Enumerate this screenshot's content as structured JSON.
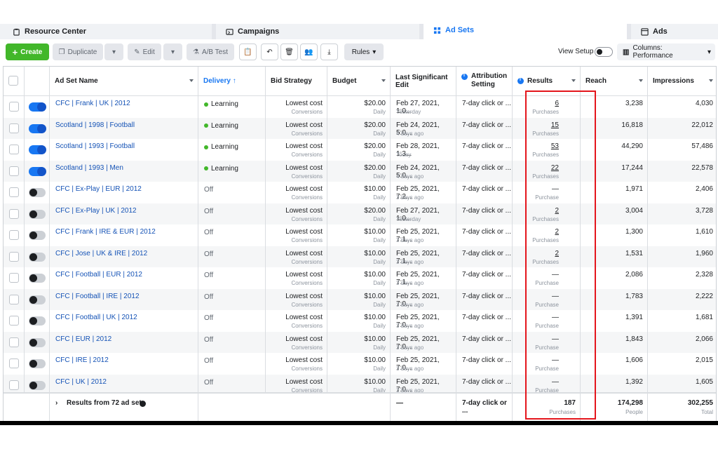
{
  "tabs": [
    {
      "label": "Resource Center",
      "icon": "clipboard-icon"
    },
    {
      "label": "Campaigns",
      "icon": "folder-icon"
    },
    {
      "label": "Ad Sets",
      "icon": "grid-icon"
    },
    {
      "label": "Ads",
      "icon": "window-icon"
    }
  ],
  "toolbar": {
    "create": "Create",
    "duplicate": "Duplicate",
    "edit": "Edit",
    "ab_test": "A/B Test",
    "rules": "Rules",
    "view_setup": "View Setup",
    "columns": "Columns: Performance"
  },
  "headers": {
    "name": "Ad Set Name",
    "delivery": "Delivery ↑",
    "bid": "Bid Strategy",
    "budget": "Budget",
    "last_edit": "Last Significant Edit",
    "attribution": "Attribution Setting",
    "results": "Results",
    "reach": "Reach",
    "impressions": "Impressions"
  },
  "rows": [
    {
      "on": true,
      "name": "CFC | Frank | UK | 2012",
      "delivery": "Learning",
      "bid": "Lowest cost",
      "bid_sub": "Conversions",
      "budget": "$20.00",
      "budget_sub": "Daily",
      "edit": "Feb 27, 2021, 1:0...",
      "edit_sub": "Yesterday",
      "attr": "7-day click or ...",
      "results": "6",
      "results_sub": "Purchases",
      "reach": "3,238",
      "impr": "4,030"
    },
    {
      "on": true,
      "name": "Scotland | 1998 | Football",
      "delivery": "Learning",
      "bid": "Lowest cost",
      "bid_sub": "Conversions",
      "budget": "$20.00",
      "budget_sub": "Daily",
      "edit": "Feb 24, 2021, 5:0...",
      "edit_sub": "4 days ago",
      "attr": "7-day click or ...",
      "results": "15",
      "results_sub": "Purchases",
      "reach": "16,818",
      "impr": "22,012"
    },
    {
      "on": true,
      "name": "Scotland | 1993 | Football",
      "delivery": "Learning",
      "bid": "Lowest cost",
      "bid_sub": "Conversions",
      "budget": "$20.00",
      "budget_sub": "Daily",
      "edit": "Feb 28, 2021, 1:3...",
      "edit_sub": "Today",
      "attr": "7-day click or ...",
      "results": "53",
      "results_sub": "Purchases",
      "reach": "44,290",
      "impr": "57,486"
    },
    {
      "on": true,
      "name": "Scotland | 1993 | Men",
      "delivery": "Learning",
      "bid": "Lowest cost",
      "bid_sub": "Conversions",
      "budget": "$20.00",
      "budget_sub": "Daily",
      "edit": "Feb 24, 2021, 5:0...",
      "edit_sub": "4 days ago",
      "attr": "7-day click or ...",
      "results": "22",
      "results_sub": "Purchases",
      "reach": "17,244",
      "impr": "22,578"
    },
    {
      "on": false,
      "name": "CFC | Ex-Play | EUR | 2012",
      "delivery": "Off",
      "bid": "Lowest cost",
      "bid_sub": "Conversions",
      "budget": "$10.00",
      "budget_sub": "Daily",
      "edit": "Feb 25, 2021, 7:2...",
      "edit_sub": "3 days ago",
      "attr": "7-day click or ...",
      "results": "—",
      "results_sub": "Purchase",
      "reach": "1,971",
      "impr": "2,406"
    },
    {
      "on": false,
      "name": "CFC | Ex-Play | UK | 2012",
      "delivery": "Off",
      "bid": "Lowest cost",
      "bid_sub": "Conversions",
      "budget": "$20.00",
      "budget_sub": "Daily",
      "edit": "Feb 27, 2021, 1:0...",
      "edit_sub": "Yesterday",
      "attr": "7-day click or ...",
      "results": "2",
      "results_sub": "Purchases",
      "reach": "3,004",
      "impr": "3,728"
    },
    {
      "on": false,
      "name": "CFC | Frank | IRE & EUR | 2012",
      "delivery": "Off",
      "bid": "Lowest cost",
      "bid_sub": "Conversions",
      "budget": "$10.00",
      "budget_sub": "Daily",
      "edit": "Feb 25, 2021, 7:1...",
      "edit_sub": "3 days ago",
      "attr": "7-day click or ...",
      "results": "2",
      "results_sub": "Purchases",
      "reach": "1,300",
      "impr": "1,610"
    },
    {
      "on": false,
      "name": "CFC | Jose | UK & IRE | 2012",
      "delivery": "Off",
      "bid": "Lowest cost",
      "bid_sub": "Conversions",
      "budget": "$10.00",
      "budget_sub": "Daily",
      "edit": "Feb 25, 2021, 7:1...",
      "edit_sub": "3 days ago",
      "attr": "7-day click or ...",
      "results": "2",
      "results_sub": "Purchases",
      "reach": "1,531",
      "impr": "1,960"
    },
    {
      "on": false,
      "name": "CFC | Football | EUR | 2012",
      "delivery": "Off",
      "bid": "Lowest cost",
      "bid_sub": "Conversions",
      "budget": "$10.00",
      "budget_sub": "Daily",
      "edit": "Feb 25, 2021, 7:1...",
      "edit_sub": "3 days ago",
      "attr": "7-day click or ...",
      "results": "—",
      "results_sub": "Purchase",
      "reach": "2,086",
      "impr": "2,328"
    },
    {
      "on": false,
      "name": "CFC | Football | IRE | 2012",
      "delivery": "Off",
      "bid": "Lowest cost",
      "bid_sub": "Conversions",
      "budget": "$10.00",
      "budget_sub": "Daily",
      "edit": "Feb 25, 2021, 7:0...",
      "edit_sub": "3 days ago",
      "attr": "7-day click or ...",
      "results": "—",
      "results_sub": "Purchase",
      "reach": "1,783",
      "impr": "2,222"
    },
    {
      "on": false,
      "name": "CFC | Football | UK | 2012",
      "delivery": "Off",
      "bid": "Lowest cost",
      "bid_sub": "Conversions",
      "budget": "$10.00",
      "budget_sub": "Daily",
      "edit": "Feb 25, 2021, 7:0...",
      "edit_sub": "3 days ago",
      "attr": "7-day click or ...",
      "results": "—",
      "results_sub": "Purchase",
      "reach": "1,391",
      "impr": "1,681"
    },
    {
      "on": false,
      "name": "CFC | EUR | 2012",
      "delivery": "Off",
      "bid": "Lowest cost",
      "bid_sub": "Conversions",
      "budget": "$10.00",
      "budget_sub": "Daily",
      "edit": "Feb 25, 2021, 7:0...",
      "edit_sub": "3 days ago",
      "attr": "7-day click or ...",
      "results": "—",
      "results_sub": "Purchase",
      "reach": "1,843",
      "impr": "2,066"
    },
    {
      "on": false,
      "name": "CFC | IRE | 2012",
      "delivery": "Off",
      "bid": "Lowest cost",
      "bid_sub": "Conversions",
      "budget": "$10.00",
      "budget_sub": "Daily",
      "edit": "Feb 25, 2021, 7:0...",
      "edit_sub": "3 days ago",
      "attr": "7-day click or ...",
      "results": "—",
      "results_sub": "Purchase",
      "reach": "1,606",
      "impr": "2,015"
    },
    {
      "on": false,
      "name": "CFC | UK | 2012",
      "delivery": "Off",
      "bid": "Lowest cost",
      "bid_sub": "Conversions",
      "budget": "$10.00",
      "budget_sub": "Daily",
      "edit": "Feb 25, 2021, 7:0...",
      "edit_sub": "3 days ago",
      "attr": "7-day click or ...",
      "results": "—",
      "results_sub": "Purchase",
      "reach": "1,392",
      "impr": "1,605"
    }
  ],
  "footer": {
    "label": "Results from 72 ad sets",
    "edit": "—",
    "attr": "7-day click or ...",
    "results": "187",
    "results_sub": "Purchases",
    "reach": "174,298",
    "reach_sub": "People",
    "impr": "302,255",
    "impr_sub": "Total"
  },
  "colors": {
    "accent": "#1877f2",
    "create": "#42b72a",
    "highlight": "#e4151c",
    "link": "#1553b6"
  }
}
